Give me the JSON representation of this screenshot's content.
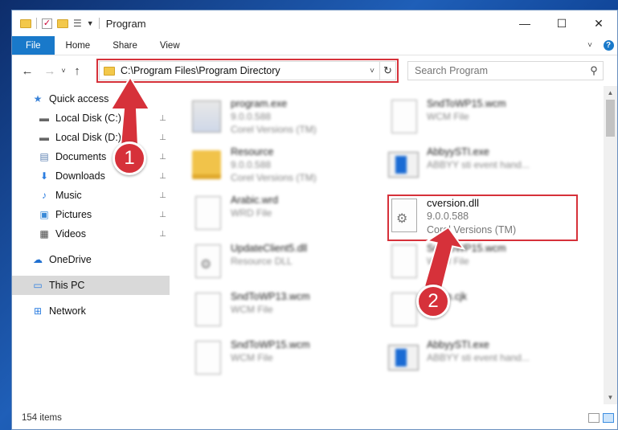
{
  "window": {
    "title": "Program",
    "controls": {
      "minimize": "—",
      "maximize": "☐",
      "close": "✕"
    }
  },
  "ribbon": {
    "tabs": [
      {
        "label": "File"
      },
      {
        "label": "Home"
      },
      {
        "label": "Share"
      },
      {
        "label": "View"
      }
    ]
  },
  "nav": {
    "back": "←",
    "forward": "→",
    "recent": "˅",
    "up": "↑",
    "address": "C:\\Program Files\\Program Directory",
    "refresh": "↻",
    "search_placeholder": "Search Program"
  },
  "sidebar": {
    "quick_access": "Quick access",
    "items": [
      {
        "label": "Local Disk (C:)",
        "icon": "disk-icon",
        "pin": "📌"
      },
      {
        "label": "Local Disk (D:)",
        "icon": "disk-icon",
        "pin": "📌"
      },
      {
        "label": "Documents",
        "icon": "documents-icon",
        "pin": "📌"
      },
      {
        "label": "Downloads",
        "icon": "downloads-icon",
        "pin": "📌"
      },
      {
        "label": "Music",
        "icon": "music-icon",
        "pin": "📌"
      },
      {
        "label": "Pictures",
        "icon": "pictures-icon",
        "pin": "📌"
      },
      {
        "label": "Videos",
        "icon": "videos-icon",
        "pin": "📌"
      }
    ],
    "onedrive": "OneDrive",
    "this_pc": "This PC",
    "network": "Network"
  },
  "files": [
    {
      "name": "program.exe",
      "sub": "9.0.0.588",
      "sub2": "Corel Versions (TM)",
      "kind": "exe"
    },
    {
      "name": "SndToWP15.wcm",
      "sub": "WCM File",
      "kind": "doc"
    },
    {
      "name": "Resource",
      "sub": "9.0.0.588",
      "sub2": "Corel Versions (TM)",
      "kind": "folder"
    },
    {
      "name": "AbbyySTI.exe",
      "sub": "ABBYY sti event hand...",
      "kind": "blue"
    },
    {
      "name": "Arabic.wrd",
      "sub": "WRD File",
      "kind": "doc"
    },
    {
      "name": "cversion.dll",
      "sub": "9.0.0.588",
      "sub2": "Corel Versions (TM)",
      "kind": "dll"
    },
    {
      "name": "UpdateClient5.dll",
      "sub": "Resource DLL",
      "kind": "dll"
    },
    {
      "name": "SndToWP15.wcm",
      "sub": "WCM File",
      "kind": "doc"
    },
    {
      "name": "SndToWP13.wcm",
      "sub": "WCM File",
      "kind": "doc"
    },
    {
      "name": "...ean.cjk",
      "sub": "...e",
      "kind": "doc"
    },
    {
      "name": "SndToWP15.wcm",
      "sub": "WCM File",
      "kind": "doc"
    },
    {
      "name": "AbbyySTI.exe",
      "sub": "ABBYY sti event hand...",
      "kind": "blue"
    }
  ],
  "status": {
    "count": "154 items"
  },
  "annotations": {
    "badge1": "1",
    "badge2": "2",
    "color": "#d6313a"
  },
  "colors": {
    "accent": "#1979ca",
    "highlight": "#d6313a",
    "selected": "#d9d9d9"
  }
}
